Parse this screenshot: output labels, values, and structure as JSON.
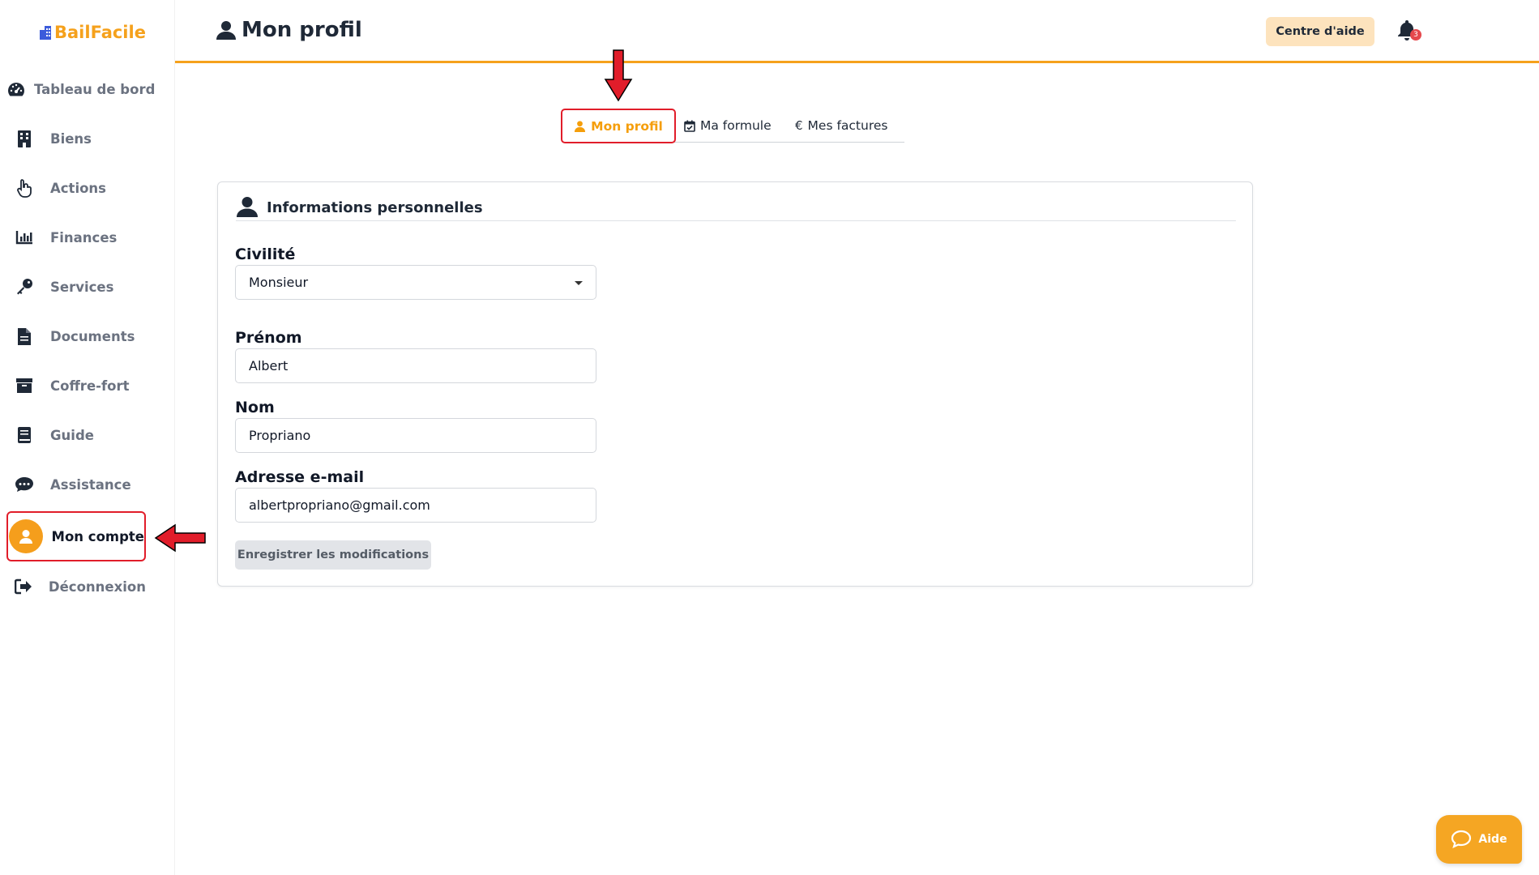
{
  "app": {
    "logo_text": "BailFacile",
    "brand_color": "#f5a11c",
    "alert_color": "#e11d2a"
  },
  "sidebar": {
    "items": [
      {
        "label": "Tableau de bord",
        "icon": "dashboard-gauge-icon"
      },
      {
        "label": "Biens",
        "icon": "building-icon"
      },
      {
        "label": "Actions",
        "icon": "hand-pointer-icon"
      },
      {
        "label": "Finances",
        "icon": "bar-chart-icon"
      },
      {
        "label": "Services",
        "icon": "key-icon"
      },
      {
        "label": "Documents",
        "icon": "document-icon"
      },
      {
        "label": "Coffre-fort",
        "icon": "archive-box-icon"
      },
      {
        "label": "Guide",
        "icon": "book-icon"
      },
      {
        "label": "Assistance",
        "icon": "chat-bubble-icon"
      },
      {
        "label": "Mon compte",
        "icon": "user-avatar-icon",
        "active": true
      },
      {
        "label": "Déconnexion",
        "icon": "sign-out-icon"
      }
    ]
  },
  "header": {
    "title": "Mon profil",
    "help_label": "Centre d'aide",
    "notifications_count": "3"
  },
  "tabs": [
    {
      "label": "Mon profil",
      "icon": "user-icon",
      "active": true
    },
    {
      "label": "Ma formule",
      "icon": "calendar-check-icon"
    },
    {
      "label": "Mes factures",
      "icon": "euro-icon"
    }
  ],
  "form": {
    "section_title": "Informations personnelles",
    "civilite_label": "Civilité",
    "civilite_value": "Monsieur",
    "prenom_label": "Prénom",
    "prenom_value": "Albert",
    "nom_label": "Nom",
    "nom_value": "Propriano",
    "email_label": "Adresse e-mail",
    "email_value": "albertpropriano@gmail.com",
    "save_label": "Enregistrer les modifications"
  },
  "help_widget": {
    "label": "Aide"
  }
}
